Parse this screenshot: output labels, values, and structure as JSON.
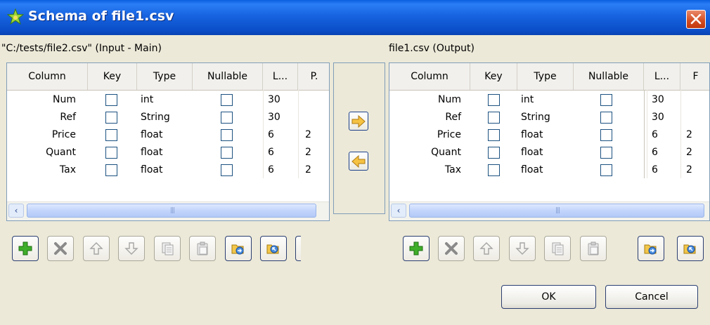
{
  "window": {
    "title": "Schema of file1.csv",
    "icon": "star-gear-icon",
    "close_label": "close-icon"
  },
  "left": {
    "label": "\"C:/tests/file2.csv\" (Input - Main)",
    "columns": [
      "Column",
      "Key",
      "Type",
      "Nullable",
      "L...",
      "P."
    ],
    "rows": [
      {
        "column": "Num",
        "type": "int",
        "length": "30",
        "precision": ""
      },
      {
        "column": "Ref",
        "type": "String",
        "length": "30",
        "precision": ""
      },
      {
        "column": "Price",
        "type": "float",
        "length": "6",
        "precision": "2"
      },
      {
        "column": "Quant",
        "type": "float",
        "length": "6",
        "precision": "2"
      },
      {
        "column": "Tax",
        "type": "float",
        "length": "6",
        "precision": "2"
      }
    ],
    "scroll_left": "‹"
  },
  "right": {
    "label": "file1.csv (Output)",
    "columns": [
      "Column",
      "Key",
      "Type",
      "Nullable",
      "L...",
      "F"
    ],
    "rows": [
      {
        "column": "Num",
        "type": "int",
        "length": "30",
        "precision": ""
      },
      {
        "column": "Ref",
        "type": "String",
        "length": "30",
        "precision": ""
      },
      {
        "column": "Price",
        "type": "float",
        "length": "6",
        "precision": "2"
      },
      {
        "column": "Quant",
        "type": "float",
        "length": "6",
        "precision": "2"
      },
      {
        "column": "Tax",
        "type": "float",
        "length": "6",
        "precision": "2"
      }
    ],
    "scroll_left": "‹"
  },
  "middle": {
    "copy_right_icon": "arrow-right-icon",
    "copy_left_icon": "arrow-left-icon"
  },
  "toolbar_icons": [
    "add-icon",
    "delete-icon",
    "move-up-icon",
    "move-down-icon",
    "copy-icon",
    "paste-icon",
    "import-icon",
    "export-icon"
  ],
  "buttons": {
    "ok": "OK",
    "cancel": "Cancel"
  },
  "colors": {
    "titlebar": "#0b4fc9",
    "dialog_bg": "#ece9d8",
    "close": "#d24b1f",
    "accent_arrow": "#f5c242"
  }
}
